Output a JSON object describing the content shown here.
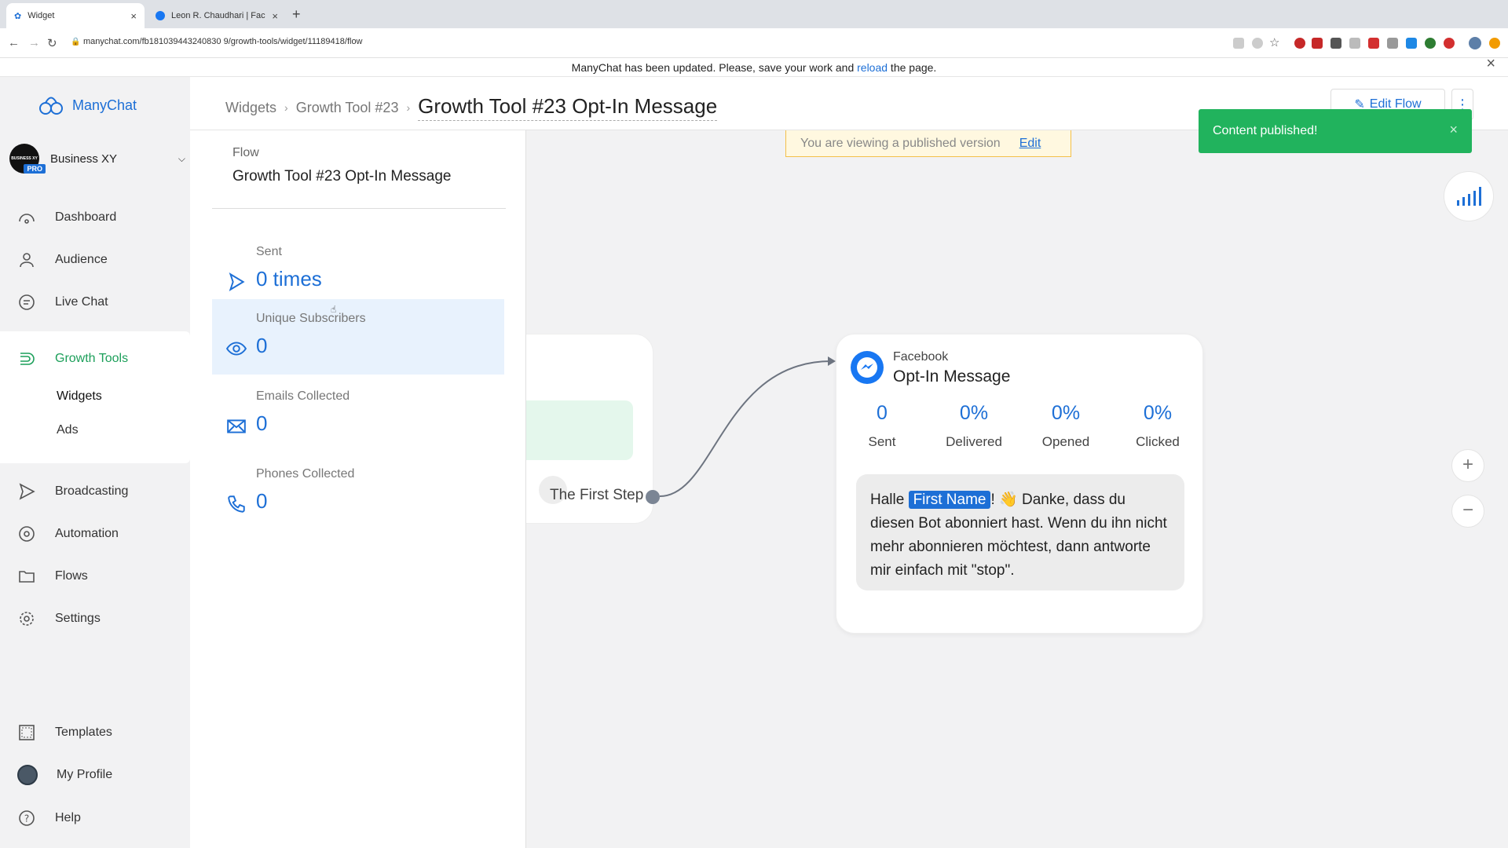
{
  "browser": {
    "tabs": [
      {
        "title": "Widget",
        "active": true
      },
      {
        "title": "Leon R. Chaudhari | Facebook",
        "active": false
      }
    ],
    "url": "manychat.com/fb181039443240830 9/growth-tools/widget/11189418/flow"
  },
  "banner": {
    "text_before": "ManyChat has been updated. Please, save your work and ",
    "link": "reload",
    "text_after": " the page."
  },
  "sidebar": {
    "brand": "ManyChat",
    "account": {
      "name": "Business XY",
      "avatar_text": "BUSINESS XY",
      "badge": "PRO"
    },
    "items": [
      {
        "label": "Dashboard",
        "icon": "dashboard-icon"
      },
      {
        "label": "Audience",
        "icon": "user-icon"
      },
      {
        "label": "Live Chat",
        "icon": "chat-icon"
      },
      {
        "label": "Growth Tools",
        "icon": "growth-tools-icon"
      },
      {
        "label": "Broadcasting",
        "icon": "broadcast-icon"
      },
      {
        "label": "Automation",
        "icon": "automation-icon"
      },
      {
        "label": "Flows",
        "icon": "folder-icon"
      },
      {
        "label": "Settings",
        "icon": "gear-icon"
      }
    ],
    "subitems": [
      {
        "label": "Widgets"
      },
      {
        "label": "Ads"
      }
    ],
    "bottom": [
      {
        "label": "Templates",
        "icon": "templates-icon"
      },
      {
        "label": "My Profile",
        "icon": "profile-avatar"
      },
      {
        "label": "Help",
        "icon": "help-icon"
      }
    ]
  },
  "header": {
    "breadcrumbs": [
      "Widgets",
      "Growth Tool #23"
    ],
    "title": "Growth Tool #23 Opt-In Message",
    "edit_flow": "Edit Flow"
  },
  "toast": {
    "text": "Content published!"
  },
  "published_bar": {
    "text": "You are viewing a published version",
    "link": "Edit"
  },
  "stats_panel": {
    "flow_label": "Flow",
    "flow_name": "Growth Tool #23 Opt-In Message",
    "stats": [
      {
        "label": "Sent",
        "value": "0 times",
        "icon": "send-icon"
      },
      {
        "label": "Unique Subscribers",
        "value": "0",
        "icon": "eye-icon"
      },
      {
        "label": "Emails Collected",
        "value": "0",
        "icon": "mail-icon"
      },
      {
        "label": "Phones Collected",
        "value": "0",
        "icon": "phone-icon"
      }
    ]
  },
  "start_card": {
    "step_label": "The First Step"
  },
  "message_card": {
    "platform": "Facebook",
    "title": "Opt-In Message",
    "metrics": [
      {
        "value": "0",
        "label": "Sent"
      },
      {
        "value": "0%",
        "label": "Delivered"
      },
      {
        "value": "0%",
        "label": "Opened"
      },
      {
        "value": "0%",
        "label": "Clicked"
      }
    ],
    "message": {
      "greeting": "Halle ",
      "variable": "First Name",
      "rest": "! 👋 Danke, dass du diesen Bot abonniert hast. Wenn du ihn nicht mehr abonnieren möchtest, dann antworte mir einfach mit \"stop\"."
    }
  },
  "colors": {
    "accent": "#1d6fd6",
    "success": "#21b35d",
    "green_nav": "#1c9f5a"
  }
}
